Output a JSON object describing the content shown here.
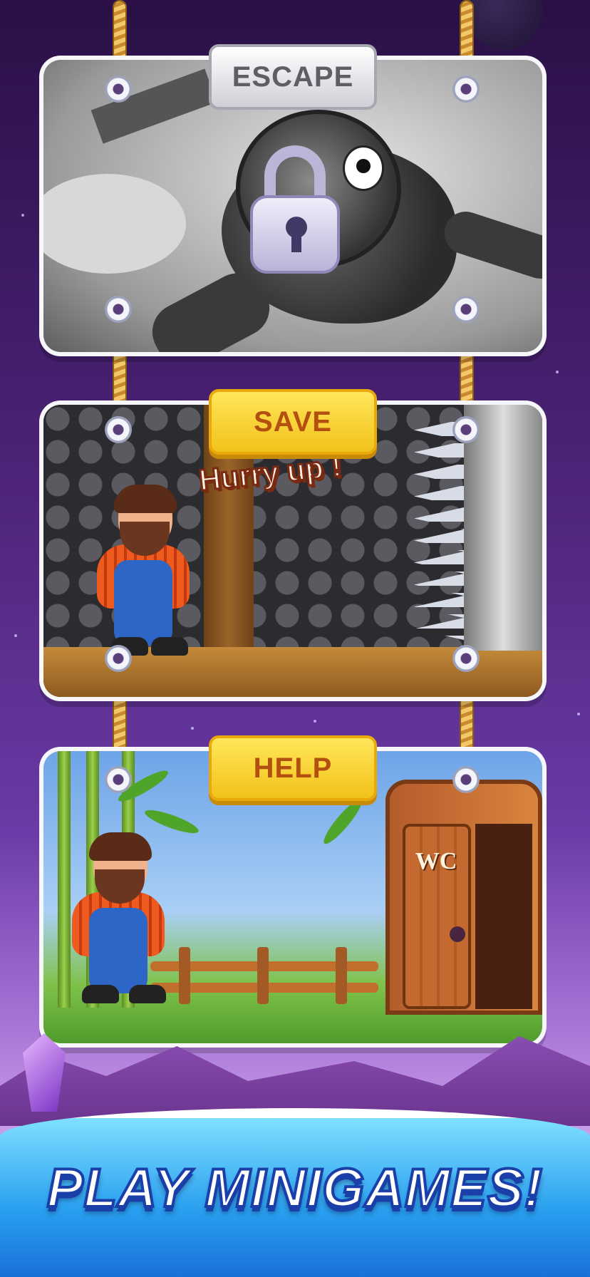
{
  "cards": [
    {
      "label": "ESCAPE",
      "state": "locked"
    },
    {
      "label": "SAVE",
      "speech": "Hurry up !"
    },
    {
      "label": "HELP",
      "sign": "WC"
    }
  ],
  "headline": "PLAY MINIGAMES!",
  "colors": {
    "background_top": "#2a1046",
    "background_bottom": "#c89be8",
    "tag_yellow": "#f2c21a",
    "tag_text_orange": "#b34f10",
    "headline_outline": "#1b3fa8"
  }
}
